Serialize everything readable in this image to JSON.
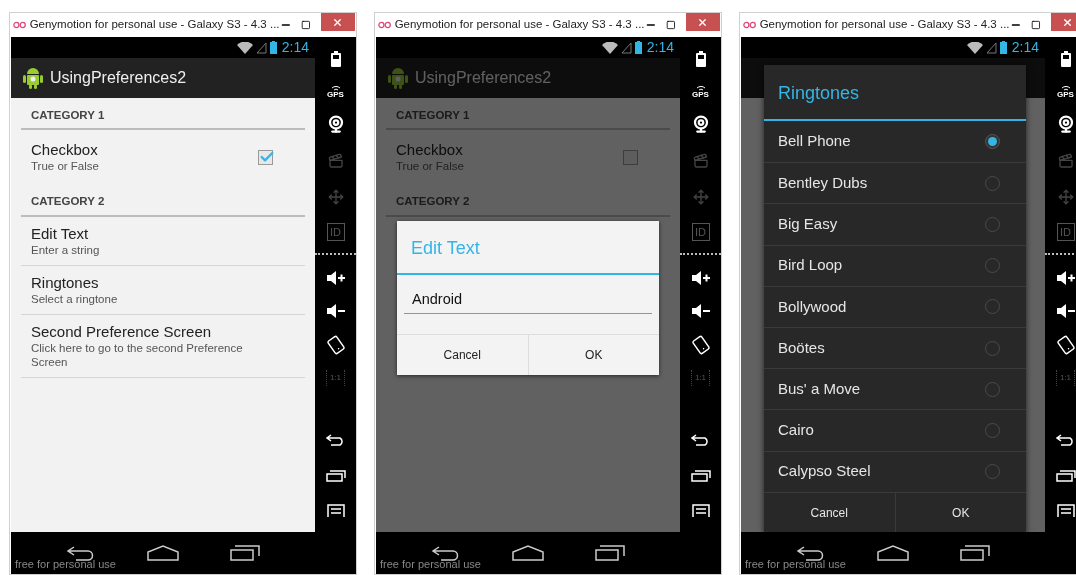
{
  "windows": [
    {
      "title": "Genymotion for personal use - Galaxy S3 - 4.3 ...",
      "time": "2:14",
      "app_bar": {
        "title": "UsingPreferences2"
      },
      "preferences": [
        {
          "kind": "category",
          "title": "CATEGORY 1"
        },
        {
          "kind": "checkbox",
          "title": "Checkbox",
          "summary": "True or False",
          "checked": true
        },
        {
          "kind": "category",
          "title": "CATEGORY 2"
        },
        {
          "kind": "text",
          "title": "Edit Text",
          "summary": "Enter a string"
        },
        {
          "kind": "text",
          "title": "Ringtones",
          "summary": "Select a ringtone"
        },
        {
          "kind": "text",
          "title": "Second Preference Screen",
          "summary": "Click here to go to the second Preference Screen"
        }
      ],
      "toolbar": {
        "gps_label": "GPS",
        "id_label": "ID",
        "scale_label": "1:1"
      },
      "overlay_text": "free for personal use"
    },
    {
      "title": "Genymotion for personal use - Galaxy S3 - 4.3 ...",
      "time": "2:14",
      "app_bar": {
        "title": "UsingPreferences2"
      },
      "preferences": [
        {
          "kind": "category",
          "title": "CATEGORY 1"
        },
        {
          "kind": "checkbox",
          "title": "Checkbox",
          "summary": "True or False",
          "checked": false
        },
        {
          "kind": "category",
          "title": "CATEGORY 2"
        }
      ],
      "dialog": {
        "kind": "edit_text",
        "title": "Edit Text",
        "value": "Android",
        "buttons": [
          "Cancel",
          "OK"
        ]
      },
      "toolbar": {
        "gps_label": "GPS",
        "id_label": "ID",
        "scale_label": "1:1"
      },
      "overlay_text": "free for personal use"
    },
    {
      "title": "Genymotion for personal use - Galaxy S3 - 4.3 ...",
      "time": "2:14",
      "dialog": {
        "kind": "list",
        "title": "Ringtones",
        "options": [
          {
            "label": "Bell Phone",
            "selected": true
          },
          {
            "label": "Bentley Dubs",
            "selected": false
          },
          {
            "label": "Big Easy",
            "selected": false
          },
          {
            "label": "Bird Loop",
            "selected": false
          },
          {
            "label": "Bollywood",
            "selected": false
          },
          {
            "label": "Boötes",
            "selected": false
          },
          {
            "label": "Bus' a Move",
            "selected": false
          },
          {
            "label": "Cairo",
            "selected": false
          },
          {
            "label": "Calypso Steel",
            "selected": false
          }
        ],
        "buttons": [
          "Cancel",
          "OK"
        ]
      },
      "toolbar": {
        "gps_label": "GPS",
        "id_label": "ID",
        "scale_label": "1:1"
      },
      "overlay_text": "free for personal use"
    }
  ]
}
